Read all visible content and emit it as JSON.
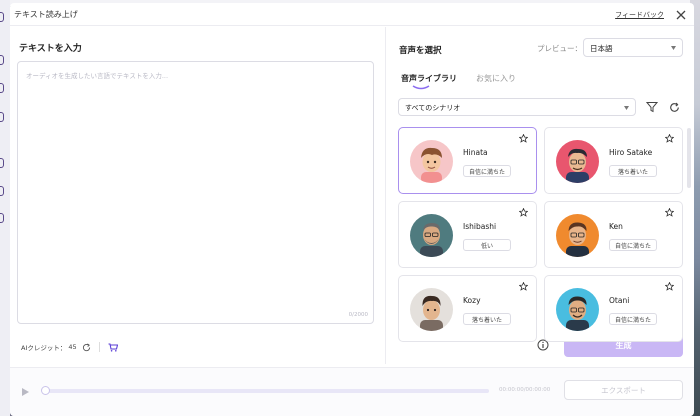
{
  "dialog": {
    "title": "テキスト読み上げ",
    "feedback_link": "フィードバック"
  },
  "left": {
    "heading": "テキストを入力",
    "textarea_placeholder": "オーディオを生成したい言語でテキストを入力...",
    "char_count": "0/2000"
  },
  "right": {
    "heading": "音声を選択",
    "preview_label": "プレビュー：",
    "language_value": "日本語",
    "tabs": [
      {
        "label": "音声ライブラリ"
      },
      {
        "label": "お気に入り"
      }
    ],
    "scenario_value": "すべてのシナリオ"
  },
  "voices": [
    {
      "name": "Hinata",
      "tag": "自信に満ちた"
    },
    {
      "name": "Hiro Satake",
      "tag": "落ち着いた"
    },
    {
      "name": "Ishibashi",
      "tag": "低い"
    },
    {
      "name": "Ken",
      "tag": "自信に満ちた"
    },
    {
      "name": "Kozy",
      "tag": "落ち着いた"
    },
    {
      "name": "Otani",
      "tag": "自信に満ちた"
    }
  ],
  "footer": {
    "credits_label": "AIクレジット：",
    "credits_value": "45",
    "generate_label": "生成",
    "time_display": "00:00:00/00:00:00",
    "export_label": "エクスポート"
  },
  "colors": {
    "accent": "#8b6cf0",
    "generate_disabled": "#c9b7f5"
  }
}
